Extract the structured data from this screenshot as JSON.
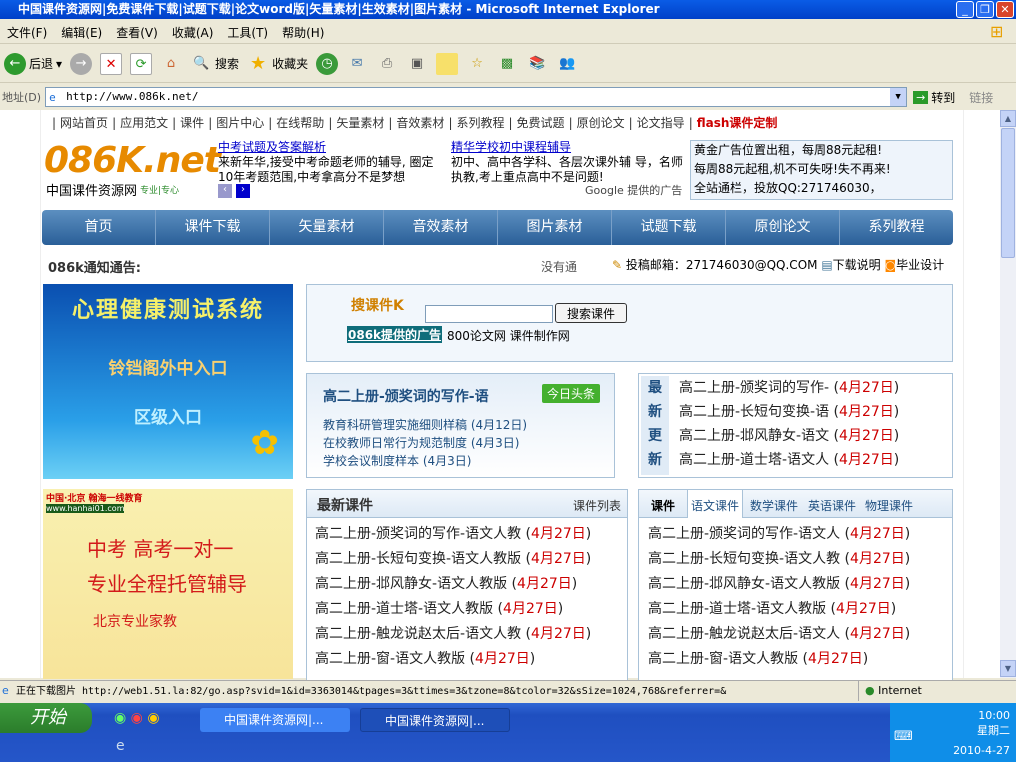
{
  "window": {
    "title": "中国课件资源网|免费课件下载|试题下载|论文word版|矢量素材|生效素材|图片素材 - Microsoft Internet Explorer"
  },
  "menu": [
    "文件(F)",
    "编辑(E)",
    "查看(V)",
    "收藏(A)",
    "工具(T)",
    "帮助(H)"
  ],
  "toolbar": {
    "back": "后退",
    "search": "搜索",
    "favorites": "收藏夹"
  },
  "address": {
    "label": "地址(D)",
    "url": "http://www.086k.net/",
    "go": "转到",
    "links": "链接"
  },
  "topnav": [
    "网站首页",
    "应用范文",
    "课件",
    "图片中心",
    "在线帮助",
    "矢量素材",
    "音效素材",
    "系列教程",
    "免费试题",
    "原创论文",
    "论文指导"
  ],
  "topnav_highlight": "flash课件定制",
  "logo": {
    "text": "086K.net",
    "subtitle": "中国课件资源网",
    "tag": "专业|专心"
  },
  "ads": [
    {
      "title": "中考试题及答案解析",
      "body": "来新年华,接受中考命题老师的辅导, 圈定10年考题范围,中考拿高分不是梦想"
    },
    {
      "title": "精华学校初中课程辅导",
      "body": "初中、高中各学科、各层次课外辅 导，名师执教,考上重点高中不是问题!"
    }
  ],
  "google_ads": "Google 提供的广告",
  "promo": [
    "黄金广告位置出租，每周88元起租!",
    "每周88元起租,机不可失呀!失不再来!",
    "全站通栏，投放QQ:271746030，"
  ],
  "mainnav": [
    "首页",
    "课件下载",
    "矢量素材",
    "音效素材",
    "图片素材",
    "试题下载",
    "原创论文",
    "系列教程"
  ],
  "notice": {
    "label": "086k通知通告:",
    "text": "没有通",
    "email": "投稿邮箱：271746030@QQ.COM",
    "help": "下载说明",
    "thesis": "毕业设计"
  },
  "banners": {
    "b1_title": "心理健康测试系统",
    "b1_line1": "铃铛阁外中入口",
    "b1_line2": "区级入口",
    "b2_brand": "中国·北京 翰海一线教育",
    "b2_url": "www.hanhai01.com",
    "b2_line1": "中考 高考一对一",
    "b2_line2": "专业全程托管辅导",
    "b2_line3": "北京专业家教"
  },
  "search": {
    "logo": "搜课件K",
    "placeholder": "",
    "button": "搜索课件",
    "ad_link": "086k提供的广告",
    "links": "800论文网 课件制作网"
  },
  "headline": {
    "title": "高二上册-颁奖词的写作-语",
    "badge": "今日头条",
    "items": [
      {
        "t": "教育科研管理实施细则样稿",
        "d": "(4月12日)"
      },
      {
        "t": "在校教师日常行为规范制度",
        "d": "(4月3日)"
      },
      {
        "t": "学校会议制度样本",
        "d": "(4月3日)"
      }
    ]
  },
  "updates": {
    "label": [
      "最",
      "新",
      "更",
      "新"
    ],
    "items": [
      {
        "t": "高二上册-颁奖词的写作-",
        "d": "4月27日"
      },
      {
        "t": "高二上册-长短句变换-语",
        "d": "4月27日"
      },
      {
        "t": "高二上册-邶风静女-语文",
        "d": "4月27日"
      },
      {
        "t": "高二上册-道士塔-语文人",
        "d": "4月27日"
      }
    ]
  },
  "latest": {
    "title": "最新课件",
    "more": "课件列表",
    "items": [
      {
        "t": "高二上册-颁奖词的写作-语文人教",
        "d": "4月27日"
      },
      {
        "t": "高二上册-长短句变换-语文人教版",
        "d": "4月27日"
      },
      {
        "t": "高二上册-邶风静女-语文人教版",
        "d": "4月27日"
      },
      {
        "t": "高二上册-道士塔-语文人教版",
        "d": "4月27日"
      },
      {
        "t": "高二上册-触龙说赵太后-语文人教",
        "d": "4月27日"
      },
      {
        "t": "高二上册-窗-语文人教版",
        "d": "4月27日"
      }
    ]
  },
  "courseware": {
    "title": "课件",
    "tabs": [
      "语文课件",
      "数学课件",
      "英语课件",
      "物理课件"
    ],
    "items": [
      {
        "t": "高二上册-颁奖词的写作-语文人",
        "d": "4月27日"
      },
      {
        "t": "高二上册-长短句变换-语文人教",
        "d": "4月27日"
      },
      {
        "t": "高二上册-邶风静女-语文人教版",
        "d": "4月27日"
      },
      {
        "t": "高二上册-道士塔-语文人教版",
        "d": "4月27日"
      },
      {
        "t": "高二上册-触龙说赵太后-语文人",
        "d": "4月27日"
      },
      {
        "t": "高二上册-窗-语文人教版",
        "d": "4月27日"
      }
    ]
  },
  "status": {
    "text": "正在下载图片 http://web1.51.la:82/go.asp?svid=1&id=3363014&tpages=3&ttimes=3&tzone=8&tcolor=32&sSize=1024,768&referrer=&",
    "zone": "Internet"
  },
  "taskbar": {
    "start": "开始",
    "tasks": [
      "中国课件资源网|...",
      "中国课件资源网|..."
    ],
    "time": "10:00",
    "weekday": "星期二",
    "date": "2010-4-27"
  }
}
